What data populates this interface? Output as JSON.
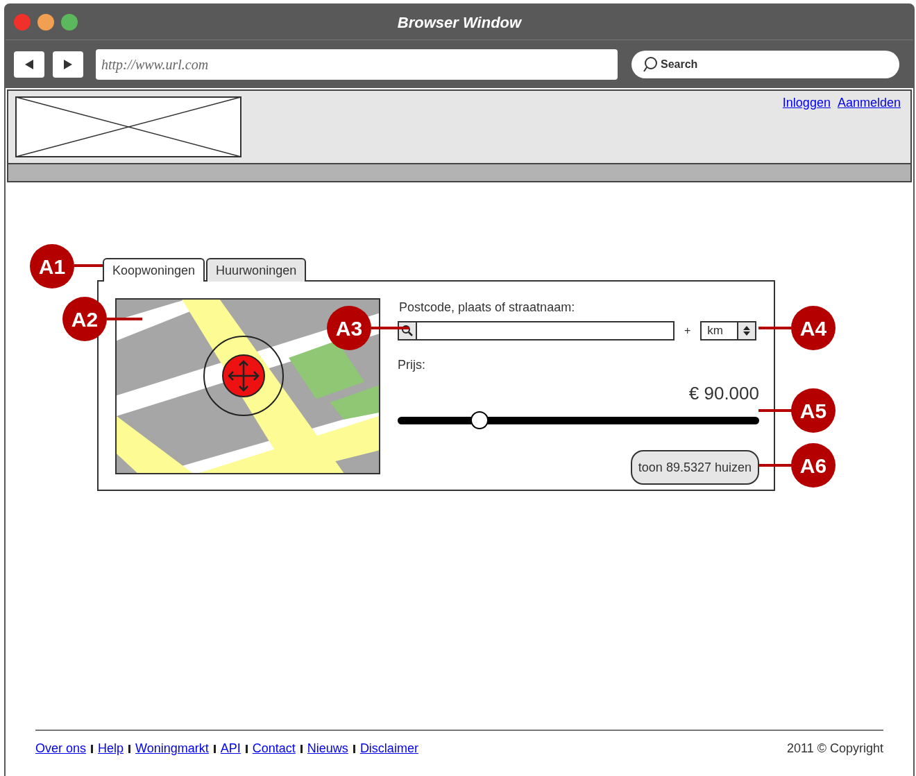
{
  "window": {
    "title": "Browser Window",
    "controls": [
      {
        "color": "#f0302a"
      },
      {
        "color": "#f0a050"
      },
      {
        "color": "#5cb85c"
      }
    ]
  },
  "toolbar": {
    "url": "http://www.url.com",
    "search_placeholder": "Search"
  },
  "header": {
    "links": [
      "Inloggen",
      "Aanmelden"
    ]
  },
  "tabs": [
    {
      "label": "Koopwoningen",
      "selected": true
    },
    {
      "label": "Huurwoningen",
      "selected": false
    }
  ],
  "search": {
    "label": "Postcode, plaats of straatnaam:",
    "plus": "+",
    "unit": "km"
  },
  "price": {
    "label": "Prijs:",
    "reading": "€ 90.000",
    "level": 0.226
  },
  "button": "toon 89.5327 huizen",
  "callouts": [
    "A1",
    "A2",
    "A3",
    "A4",
    "A5",
    "A6"
  ],
  "footer": {
    "links": [
      "Over ons",
      "Help",
      "Woningmarkt",
      "API",
      "Contact",
      "Nieuws",
      "Disclaimer"
    ],
    "copyright": "2011 © Copyright"
  }
}
